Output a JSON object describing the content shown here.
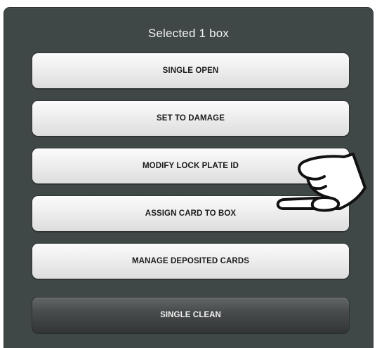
{
  "dialog": {
    "title": "Selected 1 box"
  },
  "buttons": {
    "single_open": "SINGLE OPEN",
    "set_to_damage": "SET TO DAMAGE",
    "modify_lock_plate_id": "MODIFY LOCK PLATE ID",
    "assign_card_to_box": "ASSIGN CARD TO BOX",
    "manage_deposited_cards": "MANAGE DEPOSITED CARDS",
    "single_clean": "SINGLE CLEAN"
  },
  "icons": {
    "pointer": "hand-pointer-icon"
  },
  "colors": {
    "dialog_background": "#404747",
    "button_light": "#eeeeee",
    "button_dark": "#484c4c",
    "title_text": "#f2f2f2"
  }
}
